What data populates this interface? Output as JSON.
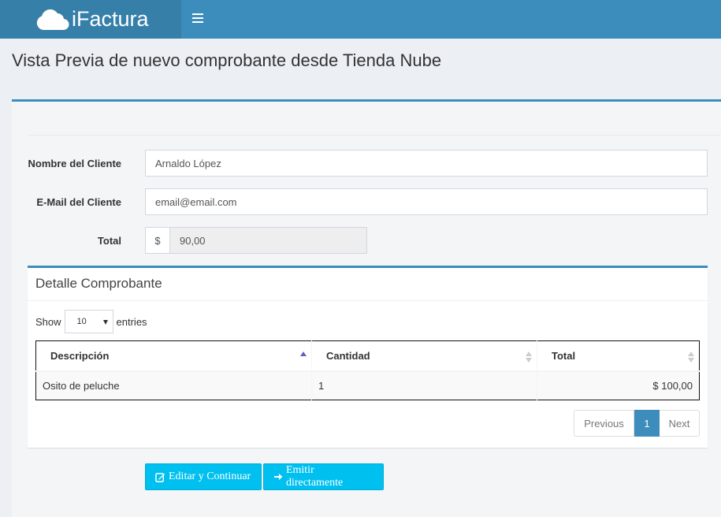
{
  "app": {
    "name": "iFactura"
  },
  "page": {
    "title": "Vista Previa de nuevo comprobante desde Tienda Nube"
  },
  "form": {
    "client_name_label": "Nombre del Cliente",
    "client_name_value": "Arnaldo López",
    "client_email_label": "E-Mail del Cliente",
    "client_email_value": "email@email.com",
    "total_label": "Total",
    "total_currency": "$",
    "total_value": "90,00"
  },
  "detail": {
    "title": "Detalle Comprobante",
    "show_label": "Show",
    "entries_label": "entries",
    "page_size": "10",
    "columns": [
      "Descripción",
      "Cantidad",
      "Total"
    ],
    "rows": [
      {
        "descripcion": "Osito de peluche",
        "cantidad": "1",
        "total": "$ 100,00"
      }
    ],
    "pagination": {
      "previous": "Previous",
      "current": "1",
      "next": "Next"
    }
  },
  "actions": {
    "edit_label": "Editar y Continuar",
    "emit_label": "Emitir directamente"
  },
  "colors": {
    "primary": "#3c8dbc",
    "logo_bg": "#367fa9",
    "info_button": "#00c0ef"
  }
}
